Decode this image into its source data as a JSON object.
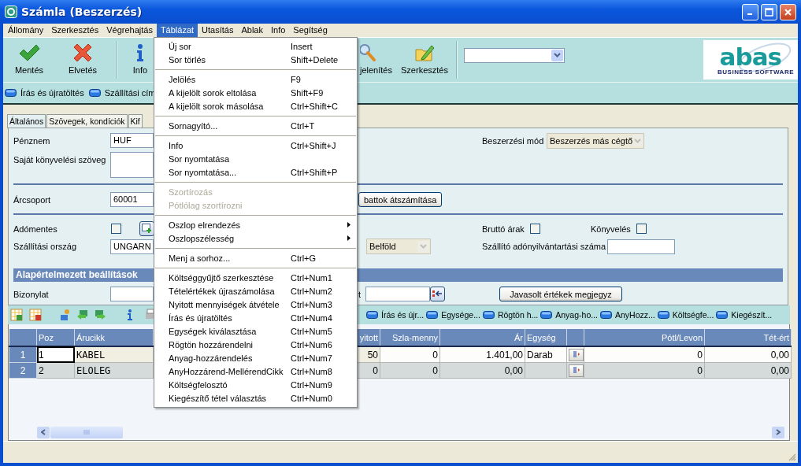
{
  "window": {
    "title": "Számla (Beszerzés)"
  },
  "menubar": [
    {
      "label": "Állomány",
      "selected": false
    },
    {
      "label": "Szerkesztés",
      "selected": false
    },
    {
      "label": "Végrehajtás",
      "selected": false
    },
    {
      "label": "Táblázat",
      "selected": true
    },
    {
      "label": "Utasítás",
      "selected": false
    },
    {
      "label": "Ablak",
      "selected": false
    },
    {
      "label": "Info",
      "selected": false
    },
    {
      "label": "Segítség",
      "selected": false
    }
  ],
  "toolbar": {
    "buttons": [
      {
        "label": "Mentés"
      },
      {
        "label": "Elvetés"
      },
      {
        "label": "Info"
      },
      {
        "label": "jelenítés"
      },
      {
        "label": "Szerkesztés"
      }
    ]
  },
  "logo": {
    "name": "abas",
    "tagline": "BUSINESS SOFTWARE"
  },
  "action_bar": [
    "Írás és újratöltés",
    "Szállítási cím"
  ],
  "tabs": [
    {
      "label": "Általános",
      "selected": true
    },
    {
      "label": "Szövegek, kondíciók",
      "selected": false
    },
    {
      "label": "Kif",
      "selected": false
    }
  ],
  "form": {
    "currency": {
      "label": "Pénznem",
      "value": "HUF"
    },
    "procurement_mode": {
      "label": "Beszerzési mód",
      "value": "Beszerzés más cégtő",
      "disabled": true
    },
    "own_booking_text": {
      "label": "Saját könyvelési szöveg"
    },
    "price_group": {
      "label": "Árcsoport",
      "value": "60001"
    },
    "recalc_button": "battok átszámítása",
    "tax_exempt": {
      "label": "Adómentes",
      "checked": false
    },
    "gross_prices": {
      "label": "Bruttó árak",
      "checked": false
    },
    "booking": {
      "label": "Könyvelés",
      "checked": false
    },
    "country": {
      "label": "Szállítási ország",
      "value": "UNGARN"
    },
    "domestic": {
      "value": "Belföld",
      "disabled": true
    },
    "supplier_tax_number": {
      "label": "Szállító adónyilvántartási száma"
    },
    "section": "Alapértelmezett beállítások",
    "document": {
      "label": "Bizonylat"
    },
    "label_fragment": "t",
    "remember_button": "Javasolt értékek megjegyz"
  },
  "grid_toolbar": [
    "Írás és újr...",
    "Egysége...",
    "Rögtön h...",
    "Anyag-ho...",
    "AnyHozz...",
    "Költségfe...",
    "Kiegészít..."
  ],
  "table": {
    "columns": [
      "Poz",
      "Árucikk",
      "yitott",
      "Szla-menny",
      "Ár",
      "Egység",
      "Pótl/Levon",
      "Tét-ért"
    ],
    "rows": [
      {
        "number": "1",
        "selected": true,
        "cells": [
          "1",
          "KABEL",
          "50",
          "0",
          "1.401,00",
          "Darab",
          "0",
          "0,00"
        ]
      },
      {
        "number": "2",
        "selected": false,
        "cells": [
          "2",
          "ELOLEG",
          "0",
          "0",
          "0,00",
          null,
          "0",
          "0,00"
        ]
      }
    ]
  },
  "menu": {
    "groups": [
      [
        {
          "label": "Új sor",
          "shortcut": "Insert",
          "disabled": false,
          "submenu": false
        },
        {
          "label": "Sor törlés",
          "shortcut": "Shift+Delete",
          "disabled": false,
          "submenu": false
        }
      ],
      [
        {
          "label": "Jelölés",
          "shortcut": "F9",
          "disabled": false,
          "submenu": false
        },
        {
          "label": "A kijelölt sorok eltolása",
          "shortcut": "Shift+F9",
          "disabled": false,
          "submenu": false
        },
        {
          "label": "A kijelölt sorok másolása",
          "shortcut": "Ctrl+Shift+C",
          "disabled": false,
          "submenu": false
        }
      ],
      [
        {
          "label": "Sornagyító...",
          "shortcut": "Ctrl+T",
          "disabled": false,
          "submenu": false
        }
      ],
      [
        {
          "label": "Info",
          "shortcut": "Ctrl+Shift+J",
          "disabled": false,
          "submenu": false
        },
        {
          "label": "Sor nyomtatása",
          "disabled": false,
          "submenu": false
        },
        {
          "label": "Sor nyomtatása...",
          "shortcut": "Ctrl+Shift+P",
          "disabled": false,
          "submenu": false
        }
      ],
      [
        {
          "label": "Szortírozás",
          "disabled": true,
          "submenu": false
        },
        {
          "label": "Pótlólag szortírozni",
          "disabled": true,
          "submenu": false
        }
      ],
      [
        {
          "label": "Oszlop elrendezés",
          "disabled": false,
          "submenu": true
        },
        {
          "label": "Oszlopszélesség",
          "disabled": false,
          "submenu": true
        }
      ],
      [
        {
          "label": "Menj a  sorhoz...",
          "shortcut": "Ctrl+G",
          "disabled": false,
          "submenu": false
        }
      ],
      [
        {
          "label": "Költséggyűjtő szerkesztése",
          "shortcut": "Ctrl+Num1",
          "disabled": false,
          "submenu": false
        },
        {
          "label": "Tételértékek újraszámolása",
          "shortcut": "Ctrl+Num2",
          "disabled": false,
          "submenu": false
        },
        {
          "label": "Nyitott mennyiségek átvétele",
          "shortcut": "Ctrl+Num3",
          "disabled": false,
          "submenu": false
        },
        {
          "label": "Írás és újratöltés",
          "shortcut": "Ctrl+Num4",
          "disabled": false,
          "submenu": false
        },
        {
          "label": "Egységek kiválasztása",
          "shortcut": "Ctrl+Num5",
          "disabled": false,
          "submenu": false
        },
        {
          "label": "Rögtön hozzárendelni",
          "shortcut": "Ctrl+Num6",
          "disabled": false,
          "submenu": false
        },
        {
          "label": "Anyag-hozzárendelés",
          "shortcut": "Ctrl+Num7",
          "disabled": false,
          "submenu": false
        },
        {
          "label": "AnyHozzárend-MellérendCikk",
          "shortcut": "Ctrl+Num8",
          "disabled": false,
          "submenu": false
        },
        {
          "label": "Költségfelosztó",
          "shortcut": "Ctrl+Num9",
          "disabled": false,
          "submenu": false
        },
        {
          "label": "Kiegészítő tétel választás",
          "shortcut": "Ctrl+Num0",
          "disabled": false,
          "submenu": false
        }
      ]
    ]
  }
}
